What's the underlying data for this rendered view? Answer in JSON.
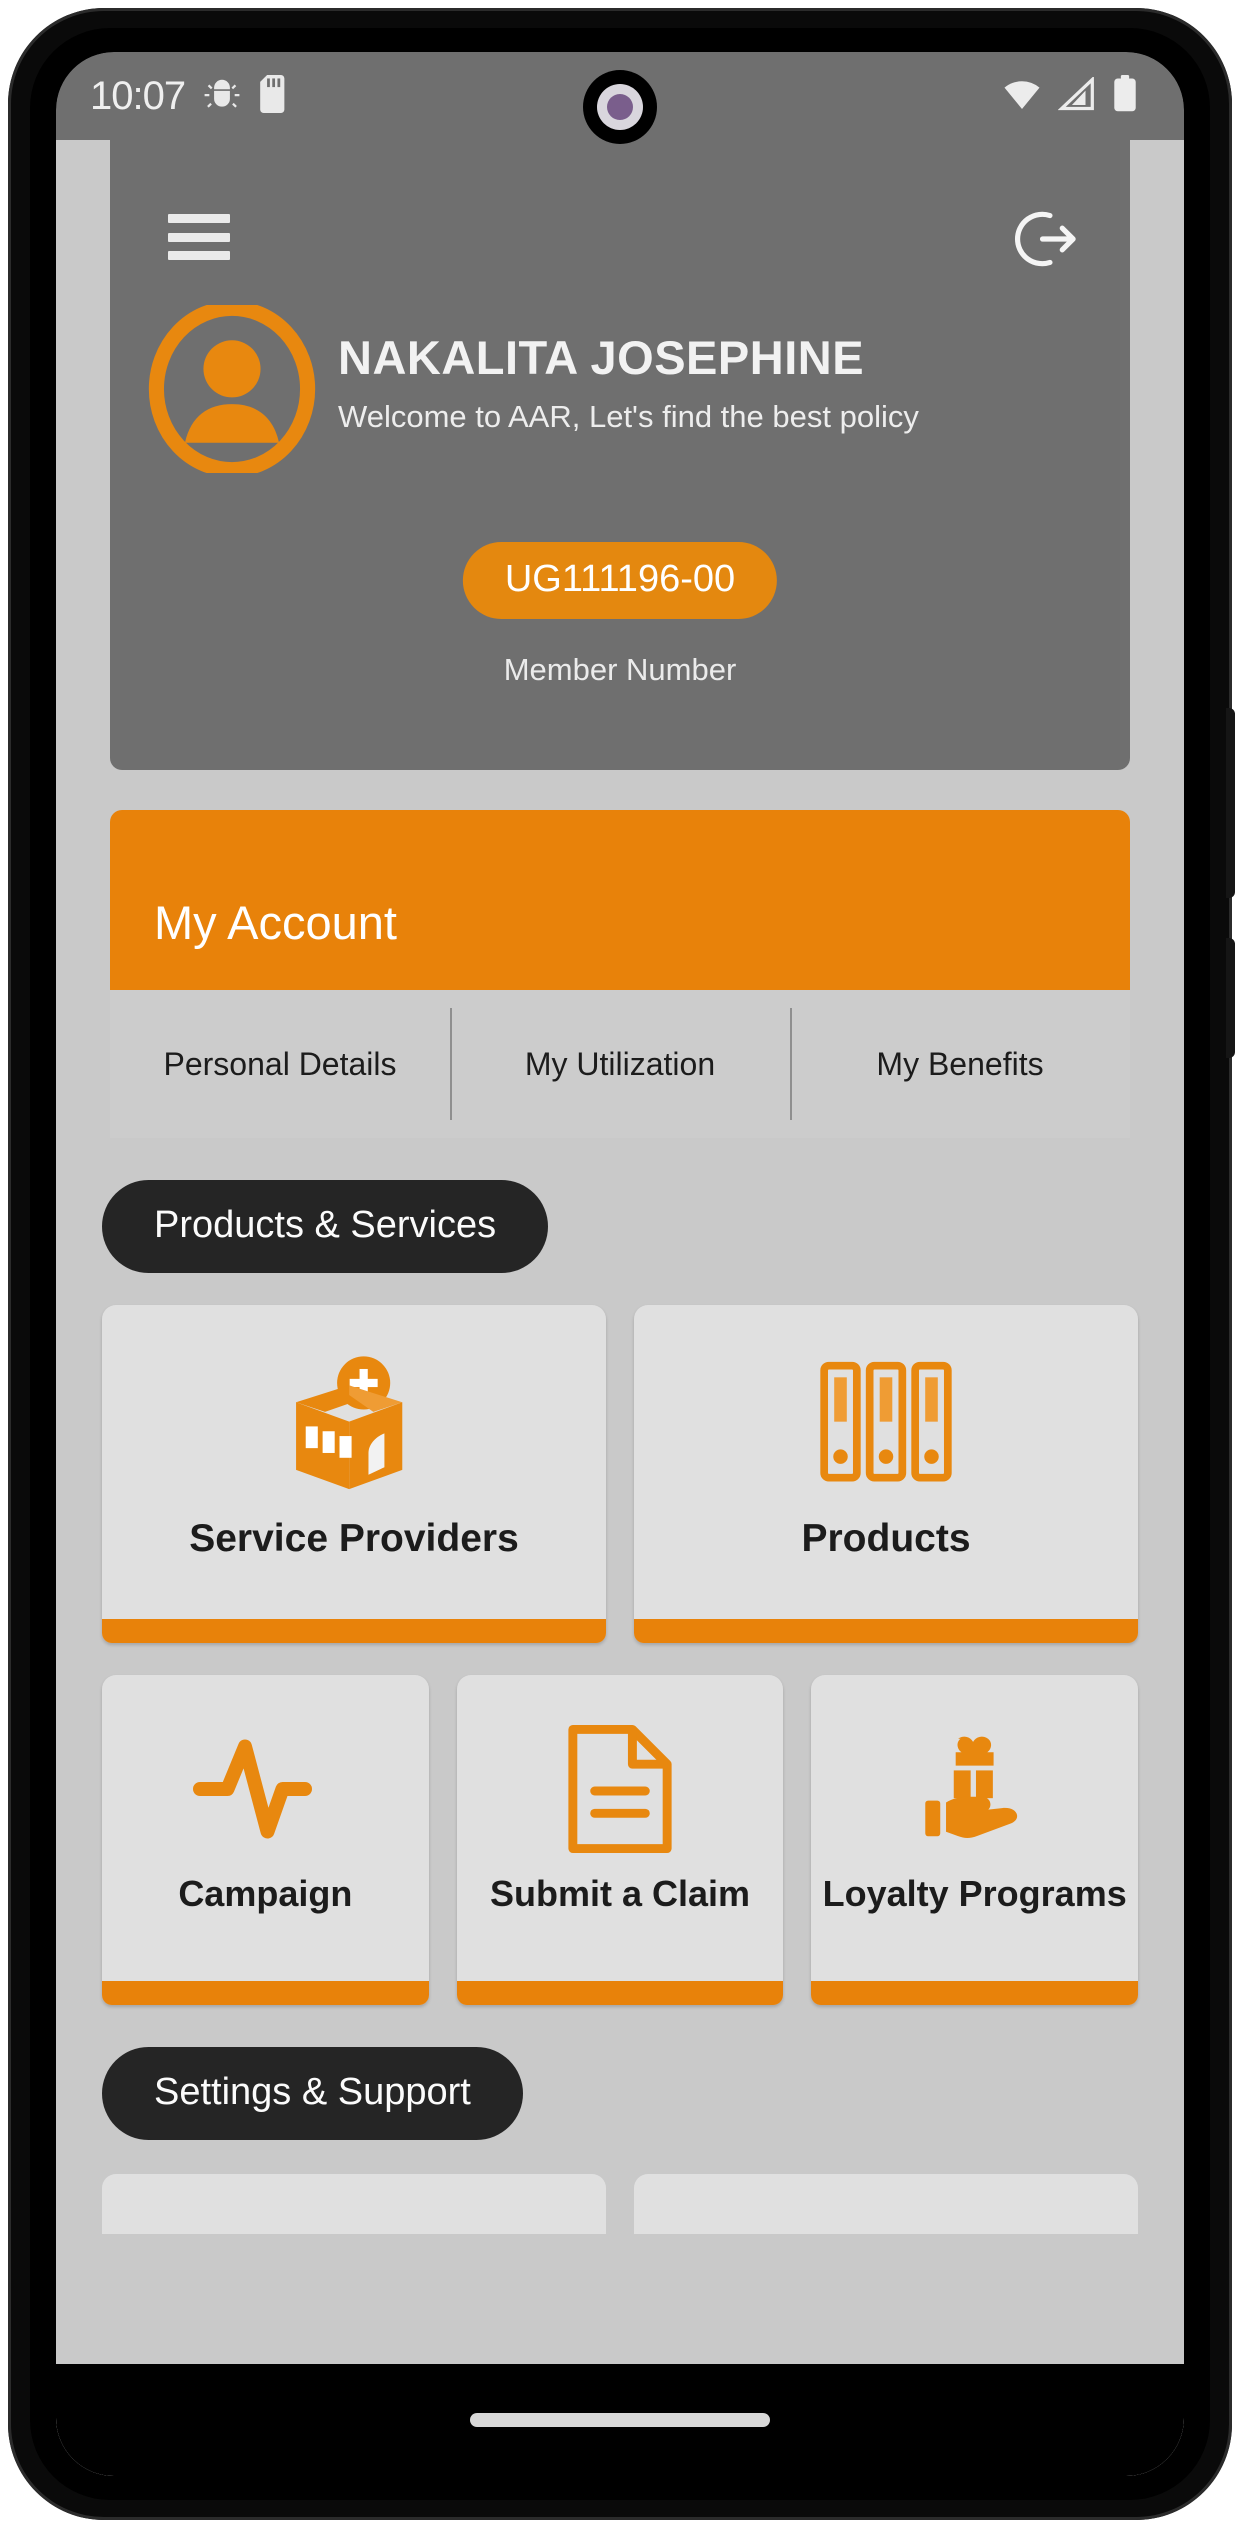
{
  "status_bar": {
    "clock": "10:07",
    "left_icons": [
      "android-bug-icon",
      "sd-card-icon"
    ],
    "right_icons": [
      "wifi-icon",
      "cellular-signal-icon",
      "battery-icon"
    ]
  },
  "header": {
    "menu_icon": "hamburger-menu-icon",
    "logout_icon": "logout-icon",
    "avatar_icon": "user-avatar-icon",
    "name": "NAKALITA JOSEPHINE",
    "welcome": "Welcome to AAR, Let's find the best policy",
    "member_number": "UG111196-00",
    "member_number_label": "Member Number",
    "background_color": "#6f6f6f"
  },
  "my_account": {
    "title": "My Account",
    "accent_color": "#e8820a",
    "tabs": [
      {
        "label": "Personal Details"
      },
      {
        "label": "My Utilization"
      },
      {
        "label": "My Benefits"
      }
    ]
  },
  "products_services": {
    "section_label": "Products & Services",
    "row1": [
      {
        "label": "Service Providers",
        "icon": "hospital-building-icon"
      },
      {
        "label": "Products",
        "icon": "binders-icon"
      }
    ],
    "row2": [
      {
        "label": "Campaign",
        "icon": "heartbeat-pulse-icon"
      },
      {
        "label": "Submit a Claim",
        "icon": "document-icon"
      },
      {
        "label": "Loyalty Programs",
        "icon": "gift-in-hand-icon"
      }
    ]
  },
  "settings_support": {
    "section_label": "Settings & Support"
  },
  "colors": {
    "brand_orange": "#e8820a",
    "badge_orange": "#e4880f",
    "header_gray": "#6f6f6f",
    "page_gray": "#c9c9c9",
    "tile_gray": "#e0e0e0",
    "pill_dark": "#252525"
  }
}
